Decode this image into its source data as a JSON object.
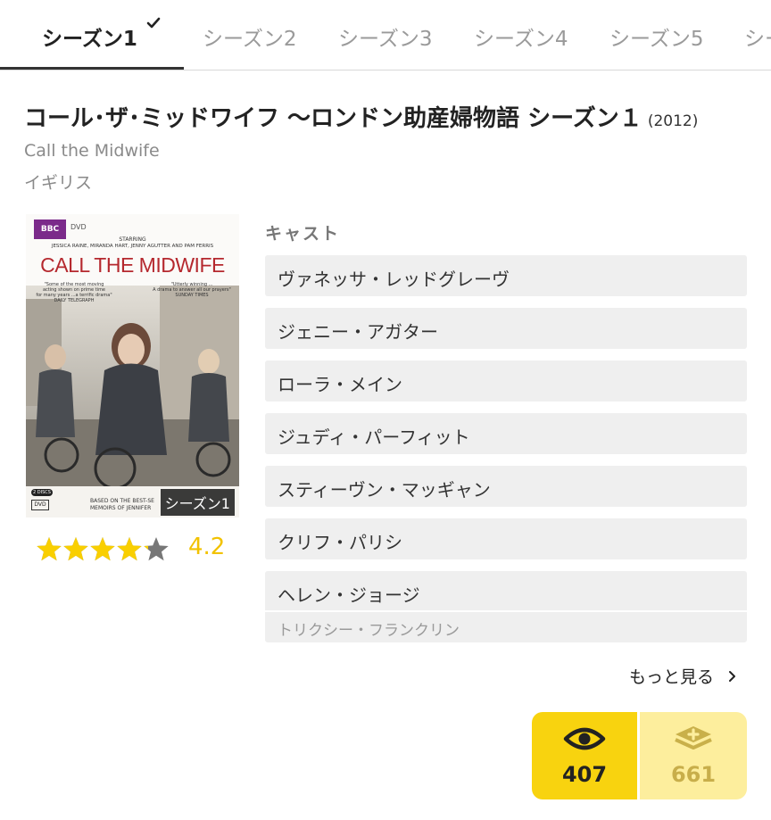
{
  "tabs": [
    {
      "label": "シーズン1"
    },
    {
      "label": "シーズン2"
    },
    {
      "label": "シーズン3"
    },
    {
      "label": "シーズン4"
    },
    {
      "label": "シーズン5"
    },
    {
      "label": "シー"
    }
  ],
  "work": {
    "title": "コール･ザ･ミッドワイフ 〜ロンドン助産婦物語 シーズン１",
    "year": "(2012)",
    "original_title": "Call the Midwife",
    "country": "イギリス"
  },
  "poster": {
    "brand": "BBC",
    "format": "DVD",
    "starring_label": "STARRING",
    "starring_line1": "JESSICA RAINE, MIRANDA HART, JENNY AGUTTER AND PAM FERRIS",
    "headline": "CALL THE MIDWIFE",
    "quote_left_1": "\"Some of the most moving",
    "quote_left_2": "acting shown on prime time",
    "quote_left_3": "for many years ...a terrific drama\"",
    "quote_left_source": "DAILY TELEGRAPH",
    "quote_right_1": "\"Utterly winning ...",
    "quote_right_2": "A drama to answer all our prayers\"",
    "quote_right_source": "SUNDAY TIMES",
    "discs": "2 DISCS",
    "based_on_1": "BASED ON THE BEST-SE",
    "based_on_2": "MEMOIRS OF JENNIFER",
    "badge": "シーズン1"
  },
  "rating": {
    "value": "4.2",
    "score": 4.2,
    "max": 5,
    "star_color": "#f9cf00",
    "empty_color": "#777777"
  },
  "cast": {
    "heading": "キャスト",
    "members": [
      "ヴァネッサ・レッドグレーヴ",
      "ジェニー・アガター",
      "ローラ・メイン",
      "ジュディ・パーフィット",
      "スティーヴン・マッギャン",
      "クリフ・パリシ",
      "ヘレン・ジョージ",
      "トリクシー・フランクリン"
    ],
    "more_label": "もっと見る",
    "more_icon": "chevron-right-icon"
  },
  "actions": {
    "watched_count": "407",
    "watched_icon": "eye-icon",
    "want_count": "661",
    "want_icon": "add-stack-icon",
    "watched_color": "#f8d30f",
    "want_color": "#fdee9d"
  }
}
